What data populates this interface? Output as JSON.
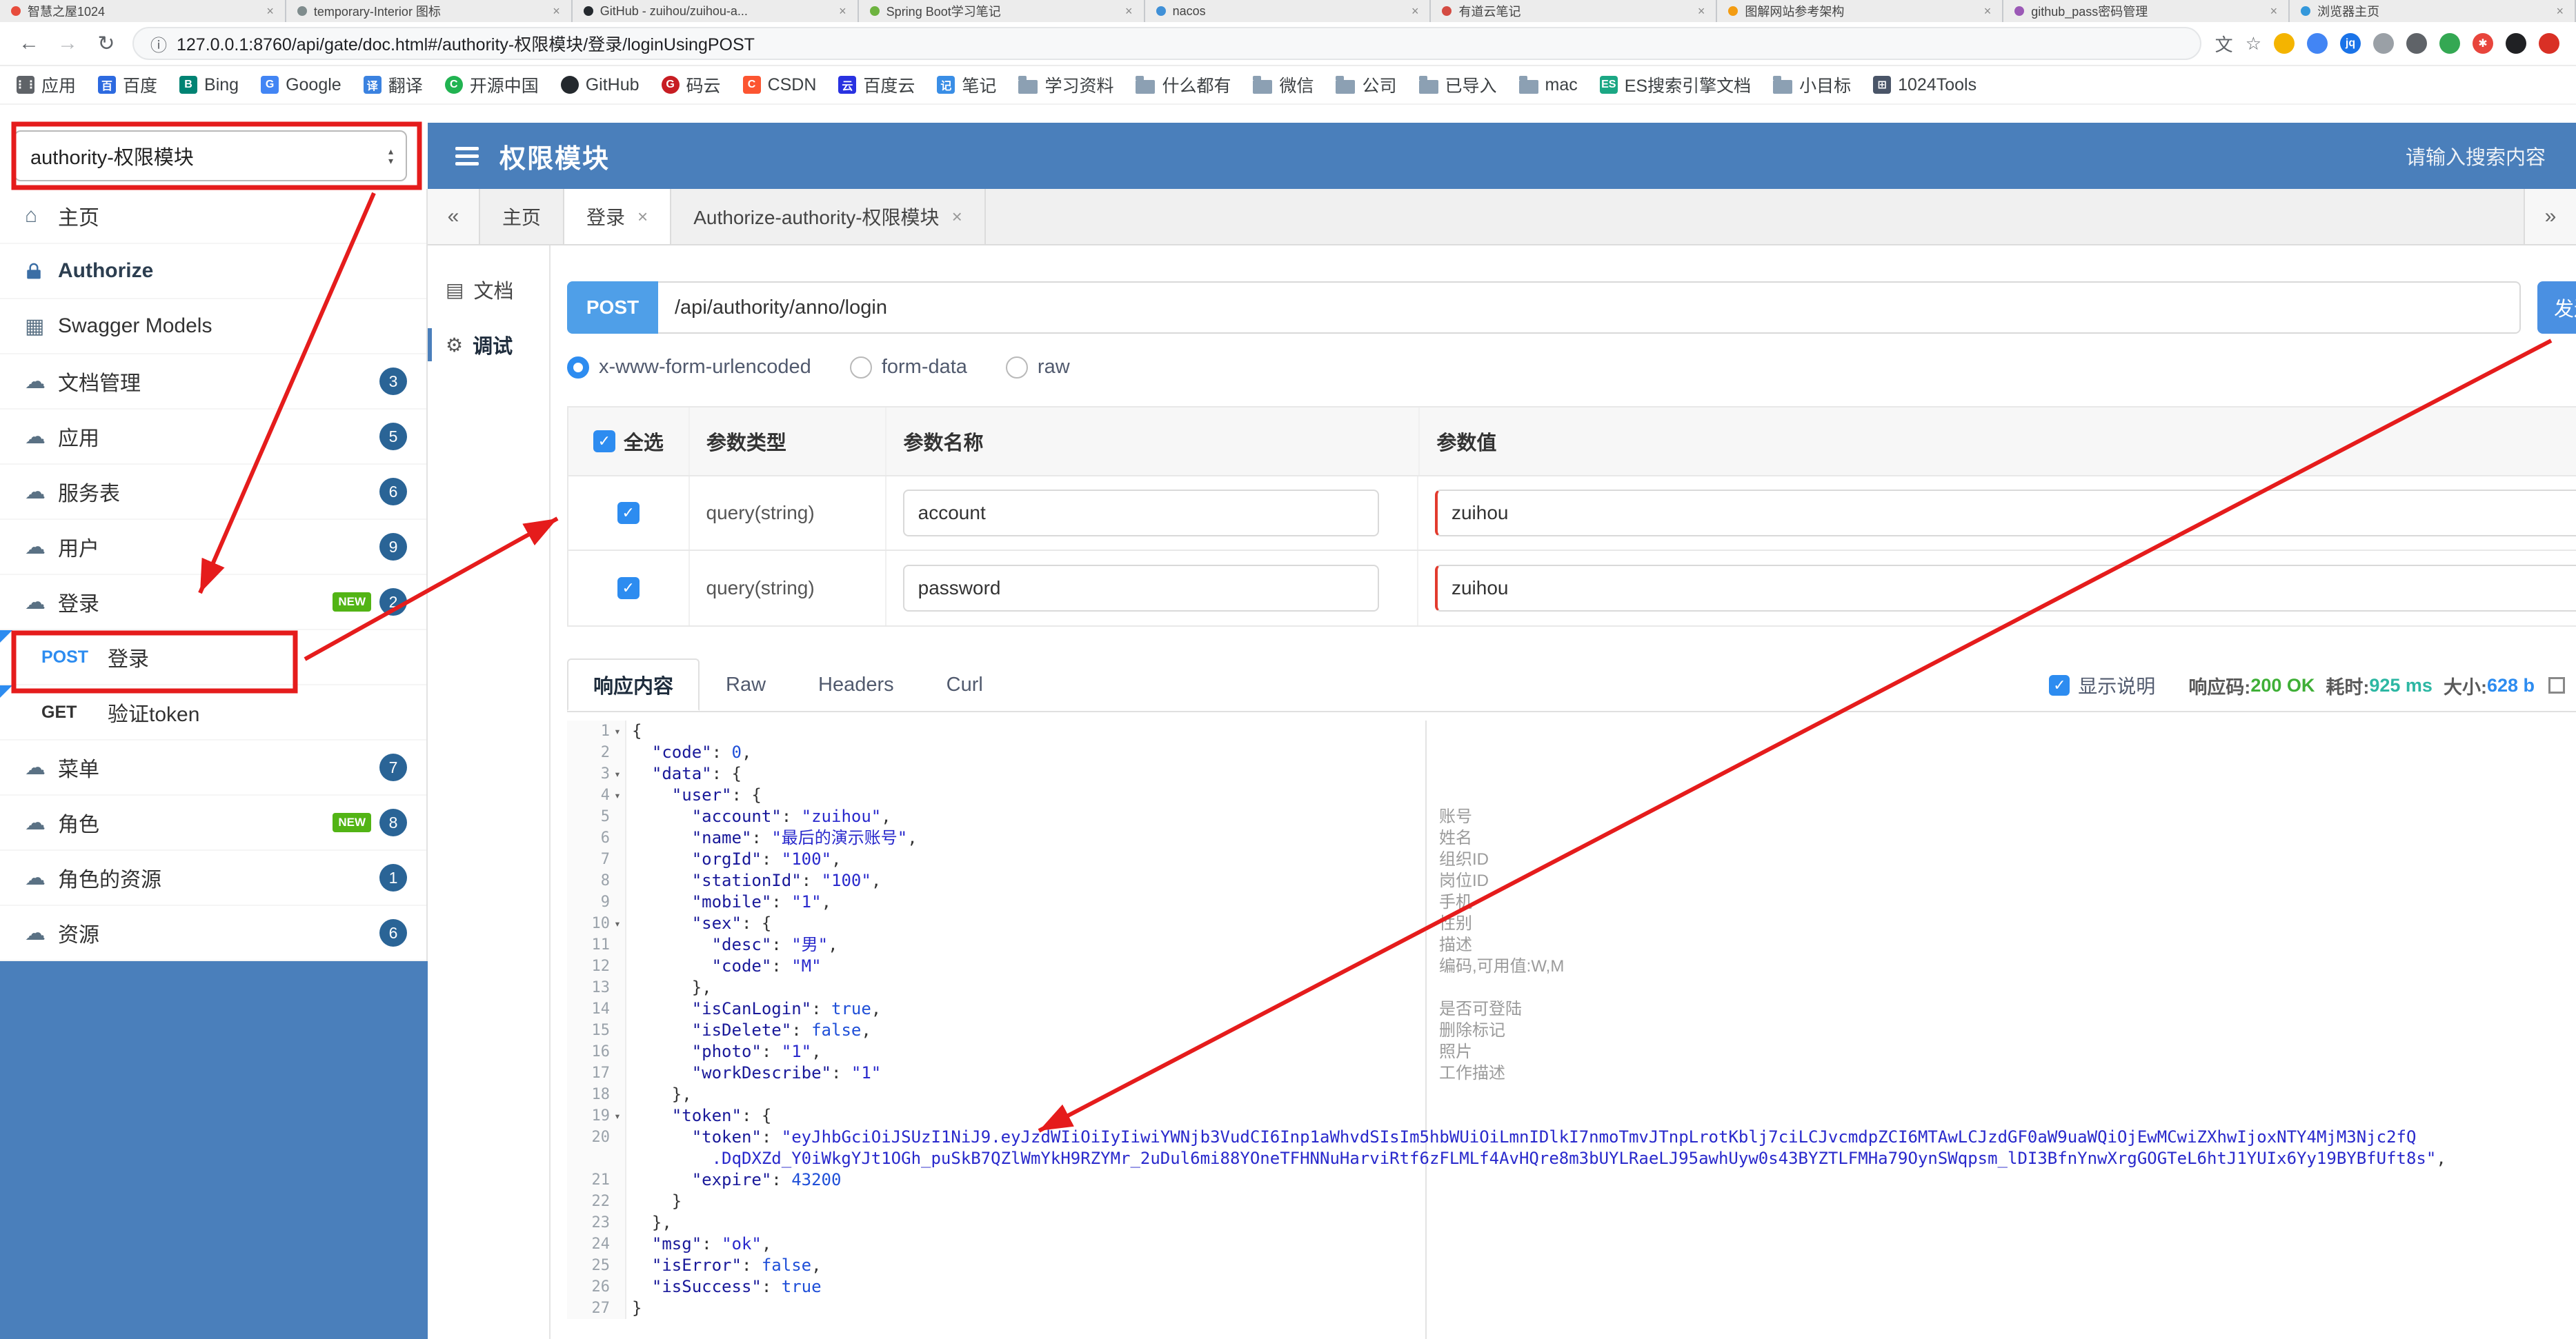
{
  "browser": {
    "tabs": [
      {
        "title": "智慧之屋1024",
        "color": "#e74c3c"
      },
      {
        "title": "temporary-Interior 图标",
        "color": "#7f8c8d"
      },
      {
        "title": "GitHub - zuihou/zuihou-a...",
        "color": "#24292e"
      },
      {
        "title": "Spring Boot学习笔记",
        "color": "#6db33f"
      },
      {
        "title": "nacos",
        "color": "#4090d7"
      },
      {
        "title": "有道云笔记",
        "color": "#d44b42"
      },
      {
        "title": "图解网站参考架构",
        "color": "#f39c12"
      },
      {
        "title": "github_pass密码管理",
        "color": "#9b59b6"
      },
      {
        "title": "浏览器主页",
        "color": "#3498db"
      }
    ],
    "url": "127.0.0.1:8760/api/gate/doc.html#/authority-权限模块/登录/loginUsingPOST",
    "toolbar_icons": [
      {
        "name": "translate-icon",
        "glyph": "文"
      },
      {
        "name": "bookmark-star-icon",
        "glyph": "☆"
      },
      {
        "name": "ext-icon-1",
        "color": "#f4b400",
        "ch": ""
      },
      {
        "name": "ext-icon-2",
        "color": "#4285f4",
        "ch": ""
      },
      {
        "name": "ext-icon-jq",
        "color": "#1a73e8",
        "ch": "jq"
      },
      {
        "name": "ext-icon-3",
        "color": "#9aa0a6",
        "ch": ""
      },
      {
        "name": "ext-icon-shield",
        "color": "#5f6368",
        "ch": ""
      },
      {
        "name": "ext-icon-4",
        "color": "#34a853",
        "ch": ""
      },
      {
        "name": "ext-icon-pinwheel",
        "color": "#e8453c",
        "ch": "✱"
      },
      {
        "name": "ext-icon-5",
        "color": "#202124",
        "ch": ""
      },
      {
        "name": "profile-avatar",
        "color": "#d93025",
        "ch": ""
      }
    ],
    "bookmarks": [
      {
        "label": "应用",
        "icon": "box",
        "color": "#5f6368",
        "ch": "⋮⋮"
      },
      {
        "label": "百度",
        "icon": "box",
        "color": "#2d6ae0",
        "ch": "百"
      },
      {
        "label": "Bing",
        "icon": "box",
        "color": "#008373",
        "ch": "B"
      },
      {
        "label": "Google",
        "icon": "box",
        "color": "#4285f4",
        "ch": "G"
      },
      {
        "label": "翻译",
        "icon": "box",
        "color": "#3b82e0",
        "ch": "译"
      },
      {
        "label": "开源中国",
        "icon": "dot",
        "color": "#21b351",
        "ch": "C"
      },
      {
        "label": "GitHub",
        "icon": "dot",
        "color": "#24292e",
        "ch": ""
      },
      {
        "label": "码云",
        "icon": "dot",
        "color": "#c71d23",
        "ch": "G"
      },
      {
        "label": "CSDN",
        "icon": "box",
        "color": "#fc5531",
        "ch": "C"
      },
      {
        "label": "百度云",
        "icon": "box",
        "color": "#2932e1",
        "ch": "云"
      },
      {
        "label": "笔记",
        "icon": "box",
        "color": "#3a8ee6",
        "ch": "记"
      },
      {
        "label": "学习资料",
        "icon": "folder"
      },
      {
        "label": "什么都有",
        "icon": "folder"
      },
      {
        "label": "微信",
        "icon": "folder"
      },
      {
        "label": "公司",
        "icon": "folder"
      },
      {
        "label": "已导入",
        "icon": "folder"
      },
      {
        "label": "mac",
        "icon": "folder"
      },
      {
        "label": "ES搜索引擎文档",
        "icon": "box",
        "color": "#1ba784",
        "ch": "ES"
      },
      {
        "label": "小目标",
        "icon": "folder"
      },
      {
        "label": "1024Tools",
        "icon": "box",
        "color": "#4a5568",
        "ch": "⊞"
      }
    ]
  },
  "header": {
    "group_select": "authority-权限模块",
    "title": "权限模块",
    "search_placeholder": "请输入搜索内容"
  },
  "sidebar": {
    "items": [
      {
        "icon": "home",
        "label": "主页"
      },
      {
        "icon": "lock",
        "label": "Authorize",
        "bold": true
      },
      {
        "icon": "models",
        "label": "Swagger Models"
      },
      {
        "icon": "cloud",
        "label": "文档管理",
        "badge": "3"
      },
      {
        "icon": "cloud",
        "label": "应用",
        "badge": "5"
      },
      {
        "icon": "cloud",
        "label": "服务表",
        "badge": "6"
      },
      {
        "icon": "cloud",
        "label": "用户",
        "badge": "9"
      },
      {
        "icon": "cloud",
        "label": "登录",
        "badge": "2",
        "new": true
      },
      {
        "method": "POST",
        "label": "登录",
        "selected": true
      },
      {
        "method": "GET",
        "label": "验证token"
      },
      {
        "icon": "cloud",
        "label": "菜单",
        "badge": "7"
      },
      {
        "icon": "cloud",
        "label": "角色",
        "badge": "8",
        "new": true
      },
      {
        "icon": "cloud",
        "label": "角色的资源",
        "badge": "1"
      },
      {
        "icon": "cloud",
        "label": "资源",
        "badge": "6"
      }
    ],
    "new_tag_text": "NEW"
  },
  "tabs": {
    "collapse_left": "«",
    "collapse_right": "»",
    "items": [
      {
        "label": "主页",
        "closable": false,
        "active": false
      },
      {
        "label": "登录",
        "closable": true,
        "active": true
      },
      {
        "label": "Authorize-authority-权限模块",
        "closable": true,
        "active": false
      }
    ]
  },
  "doc_nav": [
    {
      "icon": "doc",
      "label": "文档",
      "active": false
    },
    {
      "icon": "debug",
      "label": "调试",
      "active": true
    }
  ],
  "debug": {
    "method": "POST",
    "url": "/api/authority/anno/login",
    "send_label": "发送",
    "content_types": [
      "x-www-form-urlencoded",
      "form-data",
      "raw"
    ],
    "selected_content_type": 0,
    "params_table": {
      "select_all": "全选",
      "headers": [
        "参数类型",
        "参数名称",
        "参数值"
      ],
      "rows": [
        {
          "checked": true,
          "type": "query(string)",
          "name": "account",
          "value": "zuihou"
        },
        {
          "checked": true,
          "type": "query(string)",
          "name": "password",
          "value": "zuihou"
        }
      ]
    },
    "response_tabs": [
      {
        "label": "响应内容",
        "active": true
      },
      {
        "label": "Raw",
        "active": false
      },
      {
        "label": "Headers",
        "active": false
      },
      {
        "label": "Curl",
        "active": false
      }
    ],
    "show_desc_label": "显示说明",
    "status": {
      "code_label": "响应码:",
      "code": "200 OK",
      "time_label": "耗时:",
      "time": "925 ms",
      "size_label": "大小:",
      "size": "628 b"
    }
  },
  "editor": {
    "lines": [
      {
        "n": 1,
        "fold": true,
        "seg": [
          [
            "p",
            "{"
          ]
        ]
      },
      {
        "n": 2,
        "seg": [
          [
            "w",
            "  "
          ],
          [
            "k",
            "\"code\""
          ],
          [
            "p",
            ": "
          ],
          [
            "d",
            "0"
          ],
          [
            "p",
            ","
          ]
        ]
      },
      {
        "n": 3,
        "fold": true,
        "seg": [
          [
            "w",
            "  "
          ],
          [
            "k",
            "\"data\""
          ],
          [
            "p",
            ": {"
          ]
        ]
      },
      {
        "n": 4,
        "fold": true,
        "seg": [
          [
            "w",
            "    "
          ],
          [
            "k",
            "\"user\""
          ],
          [
            "p",
            ": {"
          ]
        ]
      },
      {
        "n": 5,
        "seg": [
          [
            "w",
            "      "
          ],
          [
            "k",
            "\"account\""
          ],
          [
            "p",
            ": "
          ],
          [
            "s",
            "\"zuihou\""
          ],
          [
            "p",
            ","
          ]
        ]
      },
      {
        "n": 6,
        "seg": [
          [
            "w",
            "      "
          ],
          [
            "k",
            "\"name\""
          ],
          [
            "p",
            ": "
          ],
          [
            "s",
            "\"最后的演示账号\""
          ],
          [
            "p",
            ","
          ]
        ]
      },
      {
        "n": 7,
        "seg": [
          [
            "w",
            "      "
          ],
          [
            "k",
            "\"orgId\""
          ],
          [
            "p",
            ": "
          ],
          [
            "s",
            "\"100\""
          ],
          [
            "p",
            ","
          ]
        ]
      },
      {
        "n": 8,
        "seg": [
          [
            "w",
            "      "
          ],
          [
            "k",
            "\"stationId\""
          ],
          [
            "p",
            ": "
          ],
          [
            "s",
            "\"100\""
          ],
          [
            "p",
            ","
          ]
        ]
      },
      {
        "n": 9,
        "seg": [
          [
            "w",
            "      "
          ],
          [
            "k",
            "\"mobile\""
          ],
          [
            "p",
            ": "
          ],
          [
            "s",
            "\"1\""
          ],
          [
            "p",
            ","
          ]
        ]
      },
      {
        "n": 10,
        "fold": true,
        "seg": [
          [
            "w",
            "      "
          ],
          [
            "k",
            "\"sex\""
          ],
          [
            "p",
            ": {"
          ]
        ]
      },
      {
        "n": 11,
        "seg": [
          [
            "w",
            "        "
          ],
          [
            "k",
            "\"desc\""
          ],
          [
            "p",
            ": "
          ],
          [
            "s",
            "\"男\""
          ],
          [
            "p",
            ","
          ]
        ]
      },
      {
        "n": 12,
        "seg": [
          [
            "w",
            "        "
          ],
          [
            "k",
            "\"code\""
          ],
          [
            "p",
            ": "
          ],
          [
            "s",
            "\"M\""
          ]
        ]
      },
      {
        "n": 13,
        "seg": [
          [
            "w",
            "      "
          ],
          [
            "p",
            "},"
          ]
        ]
      },
      {
        "n": 14,
        "seg": [
          [
            "w",
            "      "
          ],
          [
            "k",
            "\"isCanLogin\""
          ],
          [
            "p",
            ": "
          ],
          [
            "d",
            "true"
          ],
          [
            "p",
            ","
          ]
        ]
      },
      {
        "n": 15,
        "seg": [
          [
            "w",
            "      "
          ],
          [
            "k",
            "\"isDelete\""
          ],
          [
            "p",
            ": "
          ],
          [
            "d",
            "false"
          ],
          [
            "p",
            ","
          ]
        ]
      },
      {
        "n": 16,
        "seg": [
          [
            "w",
            "      "
          ],
          [
            "k",
            "\"photo\""
          ],
          [
            "p",
            ": "
          ],
          [
            "s",
            "\"1\""
          ],
          [
            "p",
            ","
          ]
        ]
      },
      {
        "n": 17,
        "seg": [
          [
            "w",
            "      "
          ],
          [
            "k",
            "\"workDescribe\""
          ],
          [
            "p",
            ": "
          ],
          [
            "s",
            "\"1\""
          ]
        ]
      },
      {
        "n": 18,
        "seg": [
          [
            "w",
            "    "
          ],
          [
            "p",
            "},"
          ]
        ]
      },
      {
        "n": 19,
        "fold": true,
        "seg": [
          [
            "w",
            "    "
          ],
          [
            "k",
            "\"token\""
          ],
          [
            "p",
            ": {"
          ]
        ]
      },
      {
        "n": 20,
        "seg": [
          [
            "w",
            "      "
          ],
          [
            "k",
            "\"token\""
          ],
          [
            "p",
            ": "
          ],
          [
            "s",
            "\"eyJhbGciOiJSUzI1NiJ9.eyJzdWIiOiIyIiwiYWNjb3VudCI6Inp1aWhvdSIsIm5hbWUiOiLmnIDlkI7nmoTmvJTnpLrotKblj7ciLCJvcmdpZCI6MTAwLCJzdGF0aW9uaWQiOjEwMCwiZXhwIjoxNTY4MjM3Njc2fQ"
          ]
        ],
        "wrap": [
          [
            "w",
            "        "
          ],
          [
            "s",
            ".DqDXZd_Y0iWkgYJt1OGh_puSkB7QZlWmYkH9RZYMr_2uDul6mi88YOneTFHNNuHarviRtf6zFLMLf4AvHQre8m3bUYLRaeLJ95awhUyw0s43BYZTLFMHa79OynSWqpsm_lDI3BfnYnwXrgGOGTeL6htJ1YUIx6Yy19BYBfUft8s\""
          ],
          [
            "p",
            ","
          ]
        ]
      },
      {
        "n": 21,
        "seg": [
          [
            "w",
            "      "
          ],
          [
            "k",
            "\"expire\""
          ],
          [
            "p",
            ": "
          ],
          [
            "d",
            "43200"
          ]
        ]
      },
      {
        "n": 22,
        "seg": [
          [
            "w",
            "    "
          ],
          [
            "p",
            "}"
          ]
        ]
      },
      {
        "n": 23,
        "seg": [
          [
            "w",
            "  "
          ],
          [
            "p",
            "},"
          ]
        ]
      },
      {
        "n": 24,
        "seg": [
          [
            "w",
            "  "
          ],
          [
            "k",
            "\"msg\""
          ],
          [
            "p",
            ": "
          ],
          [
            "s",
            "\"ok\""
          ],
          [
            "p",
            ","
          ]
        ]
      },
      {
        "n": 25,
        "seg": [
          [
            "w",
            "  "
          ],
          [
            "k",
            "\"isError\""
          ],
          [
            "p",
            ": "
          ],
          [
            "d",
            "false"
          ],
          [
            "p",
            ","
          ]
        ]
      },
      {
        "n": 26,
        "seg": [
          [
            "w",
            "  "
          ],
          [
            "k",
            "\"isSuccess\""
          ],
          [
            "p",
            ": "
          ],
          [
            "d",
            "true"
          ]
        ]
      },
      {
        "n": 27,
        "seg": [
          [
            "p",
            "}"
          ]
        ]
      }
    ],
    "field_notes": [
      {
        "line": 5,
        "text": "账号"
      },
      {
        "line": 6,
        "text": "姓名"
      },
      {
        "line": 7,
        "text": "组织ID"
      },
      {
        "line": 8,
        "text": "岗位ID"
      },
      {
        "line": 9,
        "text": "手机"
      },
      {
        "line": 10,
        "text": "性别"
      },
      {
        "line": 11,
        "text": "描述"
      },
      {
        "line": 12,
        "text": "编码,可用值:W,M"
      },
      {
        "line": 14,
        "text": "是否可登陆"
      },
      {
        "line": 15,
        "text": "删除标记"
      },
      {
        "line": 16,
        "text": "照片"
      },
      {
        "line": 17,
        "text": "工作描述"
      }
    ]
  },
  "annotations": {
    "highlight_boxes": [
      "api-group-select",
      "sidebar-post-login-item"
    ],
    "arrows": [
      {
        "from": "api-group-select",
        "to": "sidebar-post-login-item"
      },
      {
        "from": "sidebar-post-login-item",
        "to": "params-row-account"
      },
      {
        "from": "send-button",
        "to": "token-line"
      }
    ],
    "color": "#e51c1c"
  },
  "colors": {
    "header_blue": "#4a7fbb",
    "badge_blue": "#2a6496",
    "accent_blue": "#2d8cf0",
    "method_post_pill": "#4f9fe8",
    "new_green": "#52b415",
    "annotation_red": "#e51c1c",
    "status_ok_green": "#3faf37"
  }
}
